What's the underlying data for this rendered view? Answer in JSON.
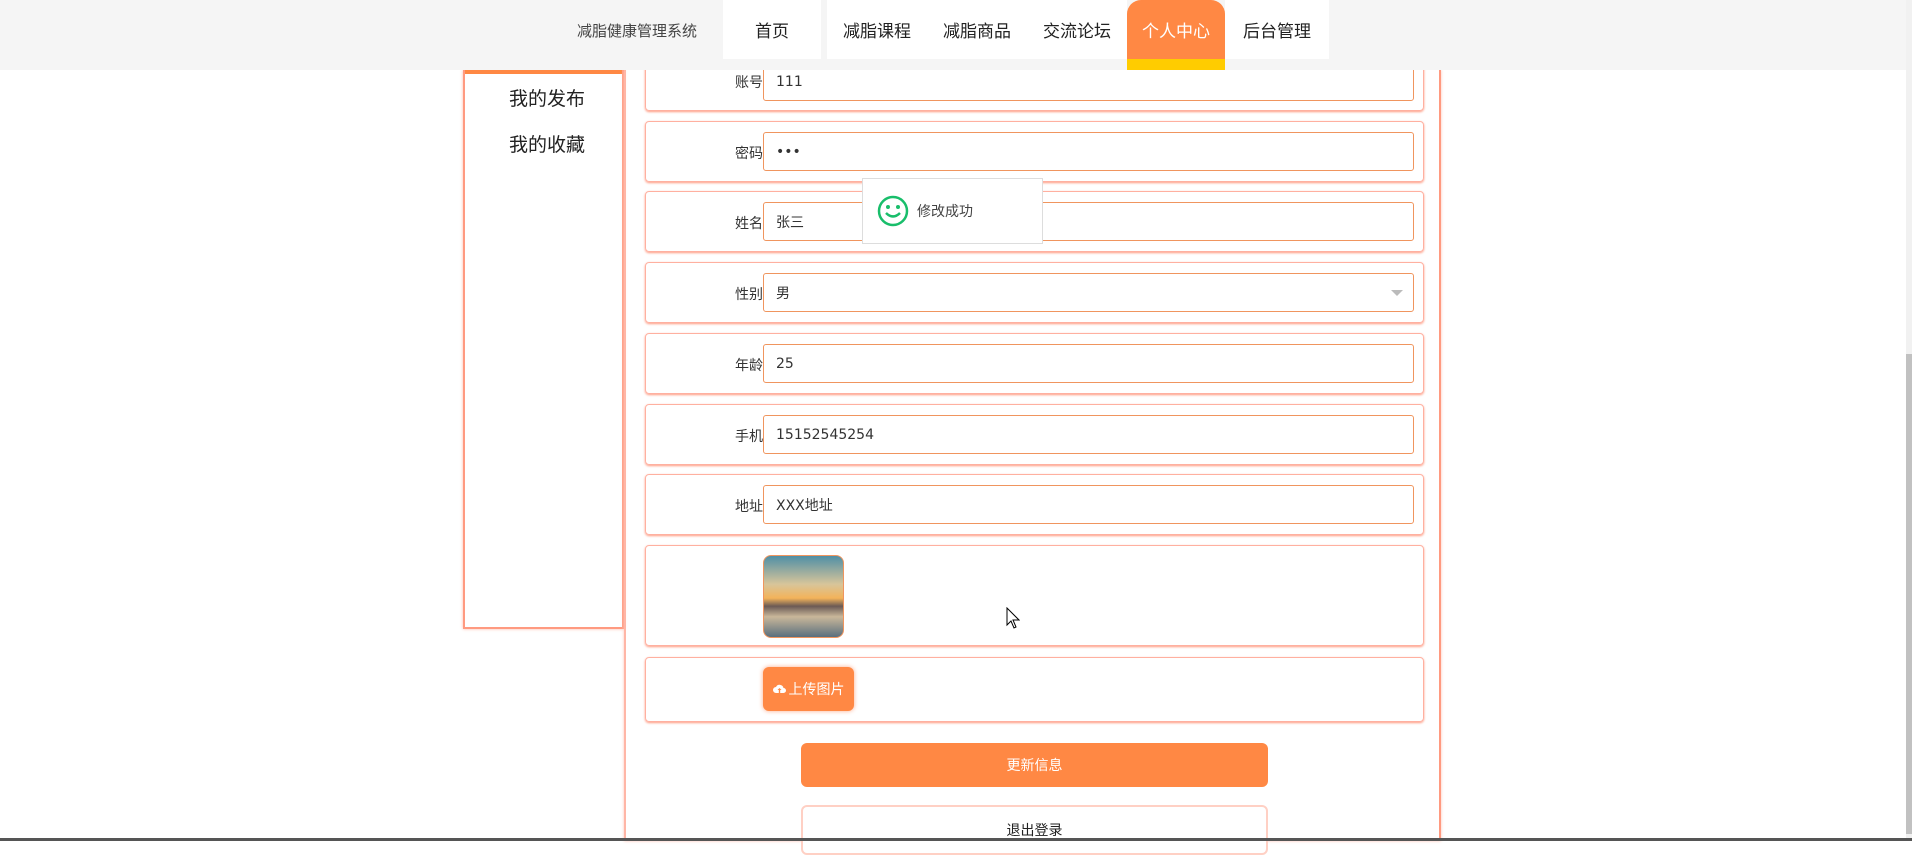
{
  "header": {
    "site_title": "减脂健康管理系统",
    "nav": [
      "首页",
      "减脂课程",
      "减脂商品",
      "交流论坛",
      "个人中心",
      "后台管理"
    ],
    "active": "个人中心"
  },
  "sidebar": {
    "items": [
      "我的发布",
      "我的收藏"
    ]
  },
  "form": {
    "account": {
      "label": "账号",
      "value": "111"
    },
    "password": {
      "label": "密码",
      "value": "•••"
    },
    "name": {
      "label": "姓名",
      "value": "张三"
    },
    "gender": {
      "label": "性别",
      "value": "男"
    },
    "age": {
      "label": "年龄",
      "value": "25"
    },
    "phone": {
      "label": "手机",
      "value": "15152545254"
    },
    "address": {
      "label": "地址",
      "value": "XXX地址"
    },
    "upload_label": "上传图片",
    "update_label": "更新信息",
    "logout_label": "退出登录"
  },
  "toast": {
    "message": "修改成功"
  },
  "colors": {
    "accent": "#ff8844",
    "highlight": "#ffcc00",
    "success": "#19be6b"
  }
}
